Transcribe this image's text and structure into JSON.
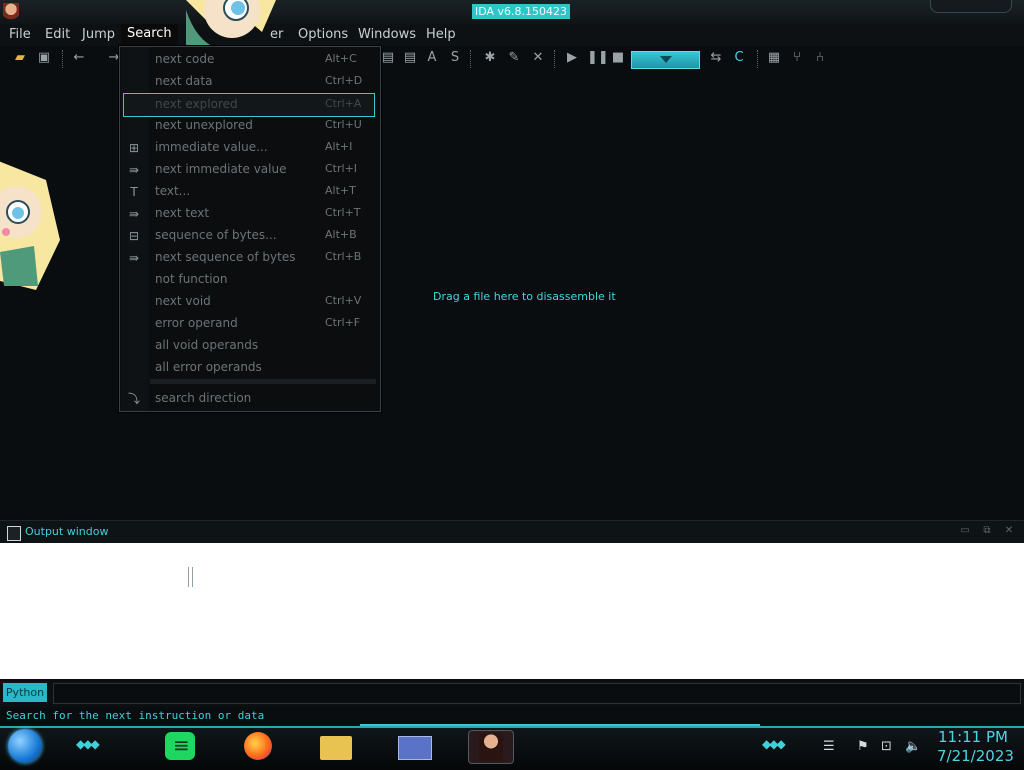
{
  "window": {
    "title": "IDA v6.8.150423"
  },
  "menubar": {
    "items": [
      {
        "label": "File"
      },
      {
        "label": "Edit"
      },
      {
        "label": "Jump"
      },
      {
        "label": "Search"
      },
      {
        "label": "er"
      },
      {
        "label": "Options"
      },
      {
        "label": "Windows"
      },
      {
        "label": "Help"
      }
    ]
  },
  "search_menu": {
    "items": [
      {
        "label": "next code",
        "shortcut": "Alt+C",
        "icon": ""
      },
      {
        "label": "next data",
        "shortcut": "Ctrl+D",
        "icon": ""
      },
      {
        "label": "next explored",
        "shortcut": "Ctrl+A",
        "icon": ""
      },
      {
        "label": "next unexplored",
        "shortcut": "Ctrl+U",
        "icon": ""
      },
      {
        "label": "immediate value...",
        "shortcut": "Alt+I",
        "icon": "search-immediate-icon"
      },
      {
        "label": "next immediate value",
        "shortcut": "Ctrl+I",
        "icon": "search-next-icon"
      },
      {
        "label": "text...",
        "shortcut": "Alt+T",
        "icon": "search-text-icon"
      },
      {
        "label": "next text",
        "shortcut": "Ctrl+T",
        "icon": "search-next-icon"
      },
      {
        "label": "sequence of bytes...",
        "shortcut": "Alt+B",
        "icon": "search-bytes-icon"
      },
      {
        "label": "next sequence of bytes",
        "shortcut": "Ctrl+B",
        "icon": "search-next-icon"
      },
      {
        "label": "not function",
        "shortcut": "",
        "icon": ""
      },
      {
        "label": "next void",
        "shortcut": "Ctrl+V",
        "icon": ""
      },
      {
        "label": "error operand",
        "shortcut": "Ctrl+F",
        "icon": ""
      },
      {
        "label": "all void operands",
        "shortcut": "",
        "icon": ""
      },
      {
        "label": "all error operands",
        "shortcut": "",
        "icon": ""
      }
    ],
    "bottom": {
      "label": "search direction",
      "icon": "arrow-down-icon"
    }
  },
  "main": {
    "drag_hint": "Drag a file here to disassemble it"
  },
  "output": {
    "title": "Output window"
  },
  "python_button": "Python",
  "status_text": "Search for the next instruction or data",
  "clock": {
    "time": "11:11 PM",
    "date": "7/21/2023"
  },
  "colors": {
    "accent": "#3fd0d9",
    "background": "#0a0d0f"
  }
}
